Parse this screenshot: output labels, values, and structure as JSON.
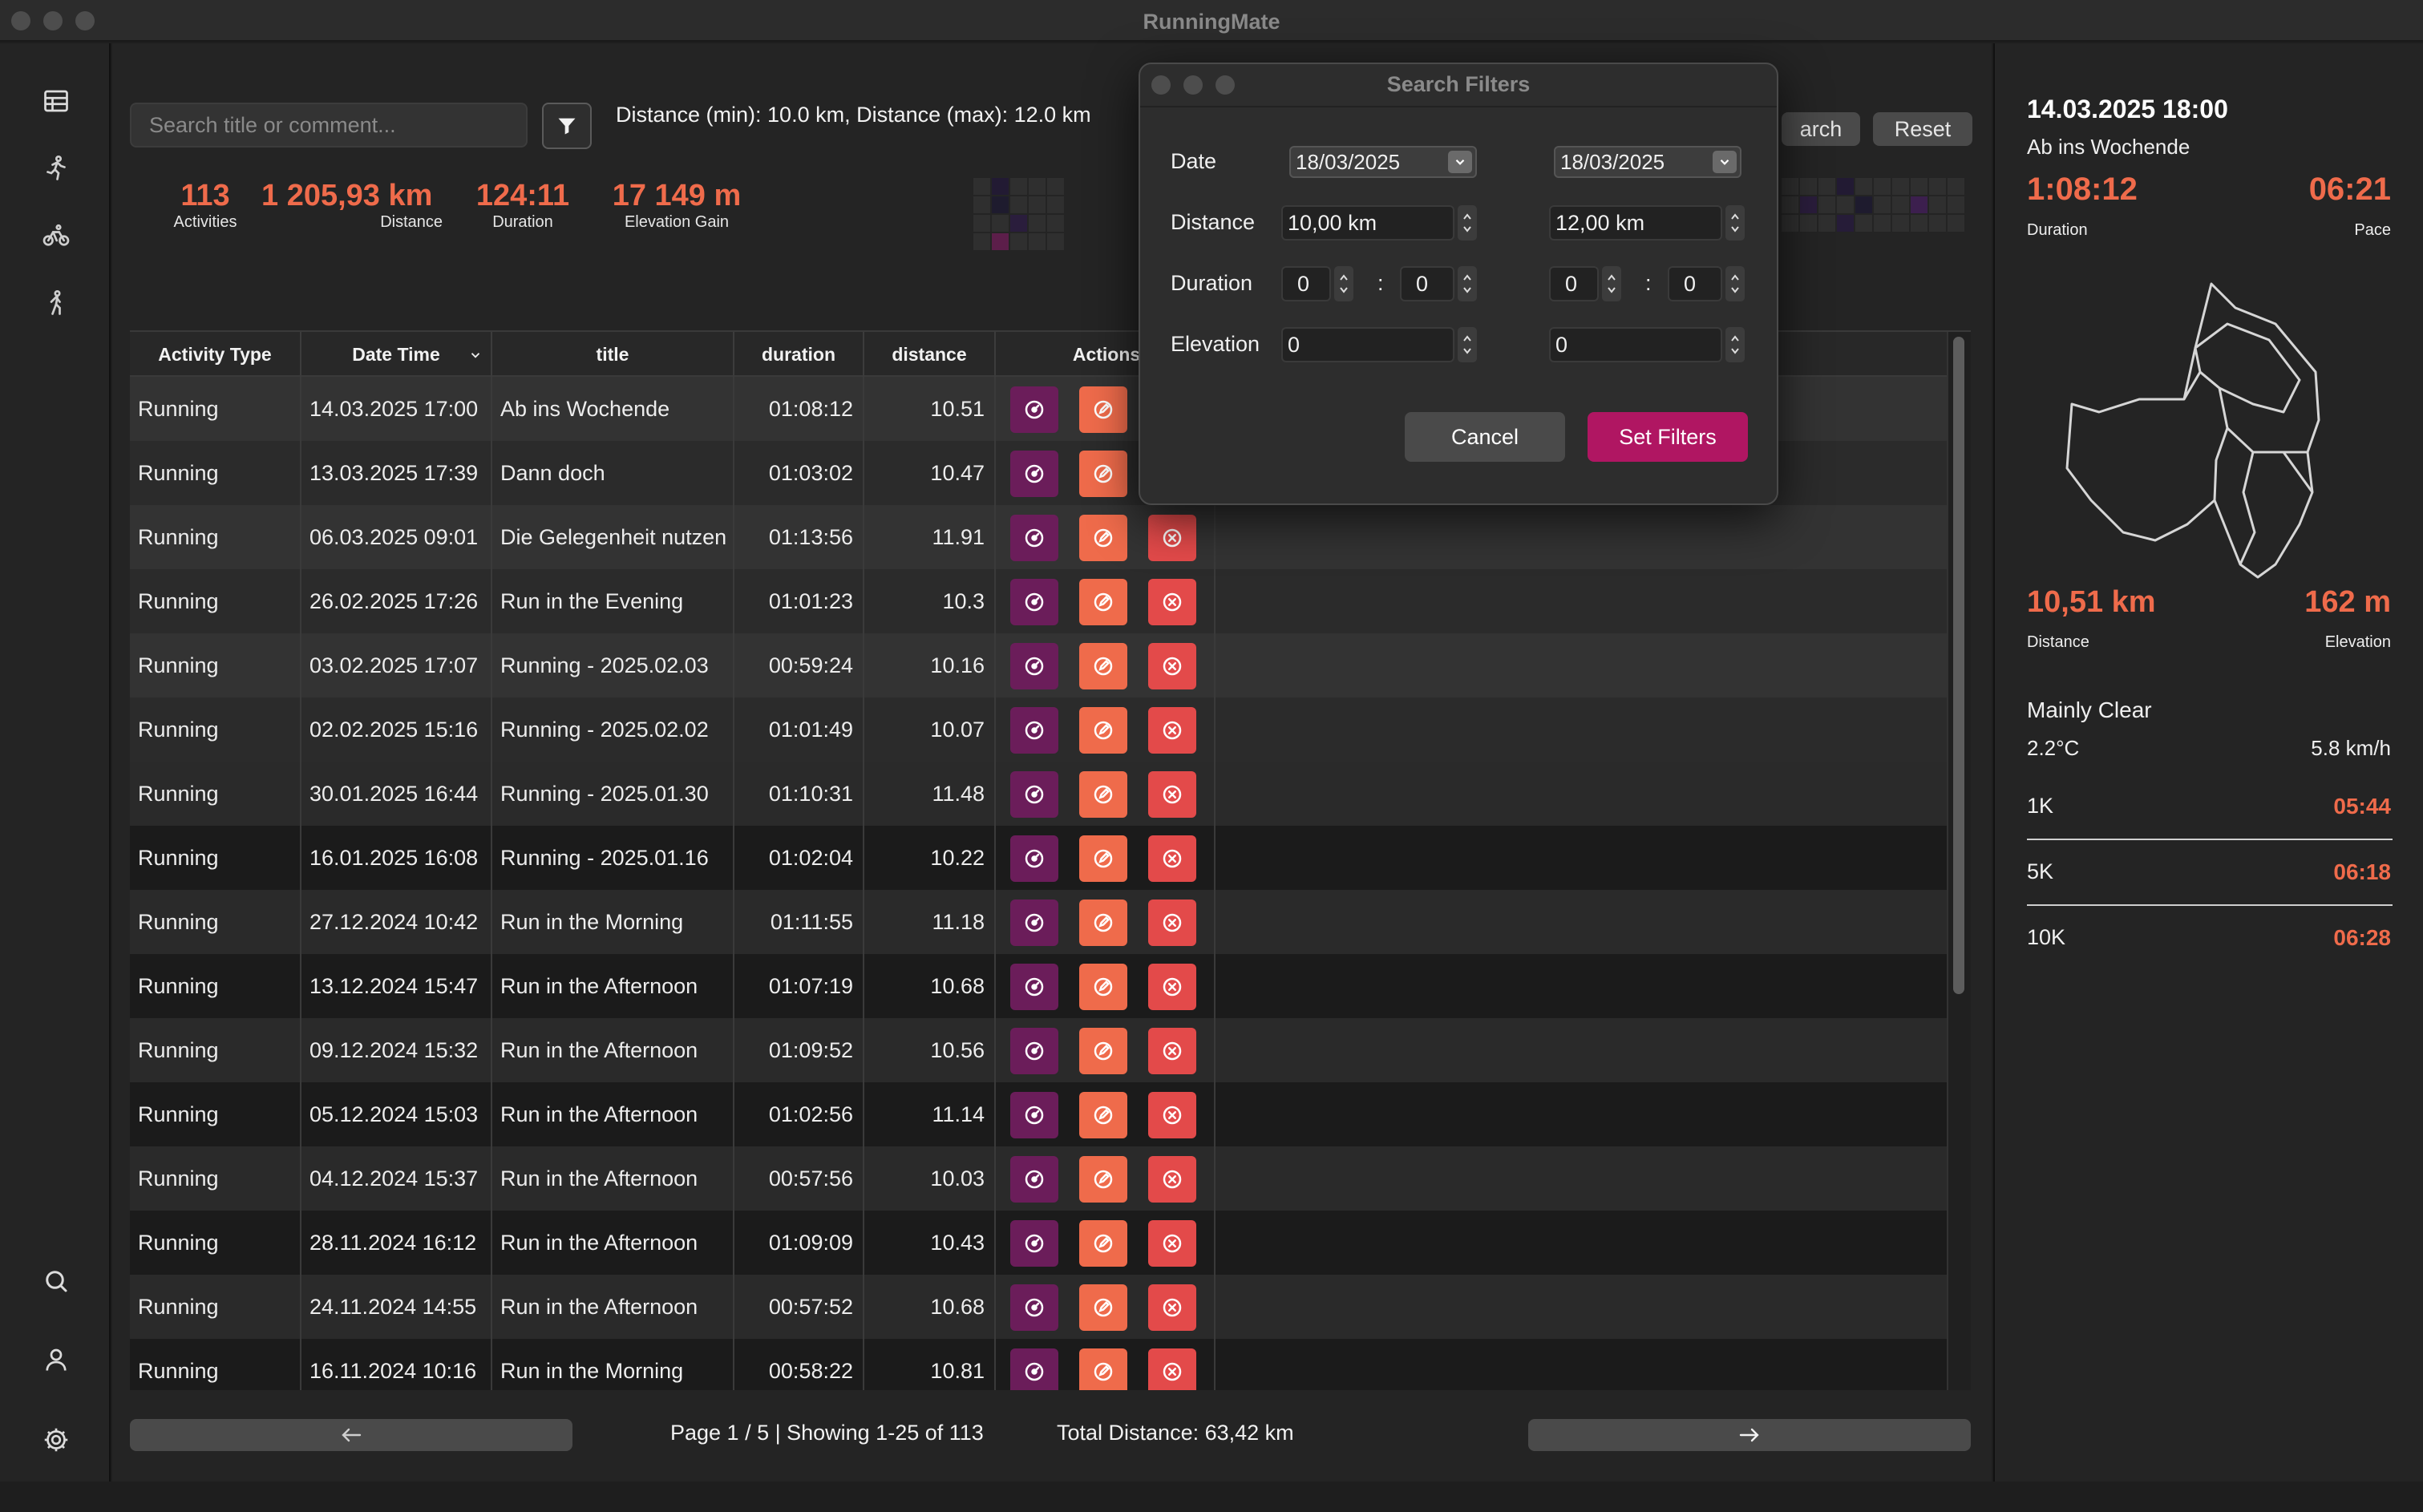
{
  "window": {
    "title": "RunningMate"
  },
  "search": {
    "placeholder": "Search title or comment...",
    "filter_summary": "Distance (min): 10.0 km, Distance (max): 12.0 km",
    "search_label": "arch",
    "reset_label": "Reset"
  },
  "stats": [
    {
      "value": "113",
      "label": "Activities"
    },
    {
      "value": "1 205,93 km",
      "label": "Distance"
    },
    {
      "value": "124:11",
      "label": "Duration"
    },
    {
      "value": "17 149 m",
      "label": "Elevation Gain"
    }
  ],
  "table": {
    "columns": [
      "Activity Type",
      "Date Time",
      "title",
      "duration",
      "distance",
      "Actions"
    ],
    "rows": [
      [
        "Running",
        "14.03.2025 17:00",
        "Ab ins Wochende",
        "01:08:12",
        "10.51"
      ],
      [
        "Running",
        "13.03.2025 17:39",
        "Dann doch",
        "01:03:02",
        "10.47"
      ],
      [
        "Running",
        "06.03.2025 09:01",
        "Die Gelegenheit nutzen",
        "01:13:56",
        "11.91"
      ],
      [
        "Running",
        "26.02.2025 17:26",
        "Run in the Evening",
        "01:01:23",
        "10.3"
      ],
      [
        "Running",
        "03.02.2025 17:07",
        "Running - 2025.02.03",
        "00:59:24",
        "10.16"
      ],
      [
        "Running",
        "02.02.2025 15:16",
        "Running - 2025.02.02",
        "01:01:49",
        "10.07"
      ],
      [
        "Running",
        "30.01.2025 16:44",
        "Running - 2025.01.30",
        "01:10:31",
        "11.48"
      ],
      [
        "Running",
        "16.01.2025 16:08",
        "Running - 2025.01.16",
        "01:02:04",
        "10.22"
      ],
      [
        "Running",
        "27.12.2024 10:42",
        "Run in the Morning",
        "01:11:55",
        "11.18"
      ],
      [
        "Running",
        "13.12.2024 15:47",
        "Run in the Afternoon",
        "01:07:19",
        "10.68"
      ],
      [
        "Running",
        "09.12.2024 15:32",
        "Run in the Afternoon",
        "01:09:52",
        "10.56"
      ],
      [
        "Running",
        "05.12.2024 15:03",
        "Run in the Afternoon",
        "01:02:56",
        "11.14"
      ],
      [
        "Running",
        "04.12.2024 15:37",
        "Run in the Afternoon",
        "00:57:56",
        "10.03"
      ],
      [
        "Running",
        "28.11.2024 16:12",
        "Run in the Afternoon",
        "01:09:09",
        "10.43"
      ],
      [
        "Running",
        "24.11.2024 14:55",
        "Run in the Afternoon",
        "00:57:52",
        "10.68"
      ],
      [
        "Running",
        "16.11.2024 10:16",
        "Run in the Morning",
        "00:58:22",
        "10.81"
      ]
    ]
  },
  "pagination": {
    "page_info": "Page 1 / 5 | Showing 1-25 of 113",
    "total_distance": "Total Distance: 63,42 km"
  },
  "detail": {
    "date": "14.03.2025 18:00",
    "title": "Ab ins Wochende",
    "duration": "1:08:12",
    "duration_label": "Duration",
    "pace": "06:21",
    "pace_label": "Pace",
    "distance": "10,51 km",
    "distance_label": "Distance",
    "elevation": "162 m",
    "elevation_label": "Elevation",
    "weather": "Mainly Clear",
    "temperature": "2.2°C",
    "wind": "5.8 km/h",
    "splits": [
      {
        "label": "1K",
        "value": "05:44"
      },
      {
        "label": "5K",
        "value": "06:18"
      },
      {
        "label": "10K",
        "value": "06:28"
      }
    ]
  },
  "dialog": {
    "title": "Search Filters",
    "labels": {
      "date": "Date",
      "distance": "Distance",
      "duration": "Duration",
      "elevation": "Elevation"
    },
    "date_from": "18/03/2025",
    "date_to": "18/03/2025",
    "distance_min": "10,00 km",
    "distance_max": "12,00 km",
    "duration_min_h": "0",
    "duration_min_m": "0",
    "duration_max_h": "0",
    "duration_max_m": "0",
    "colon": ":",
    "elevation_min": "0",
    "elevation_max": "0",
    "cancel_label": "Cancel",
    "submit_label": "Set Filters"
  },
  "colors": {
    "accent": "#ef6b4b",
    "view_button": "#6b1d5a",
    "delete_button": "#e34a4a",
    "primary_button": "#b01662"
  }
}
